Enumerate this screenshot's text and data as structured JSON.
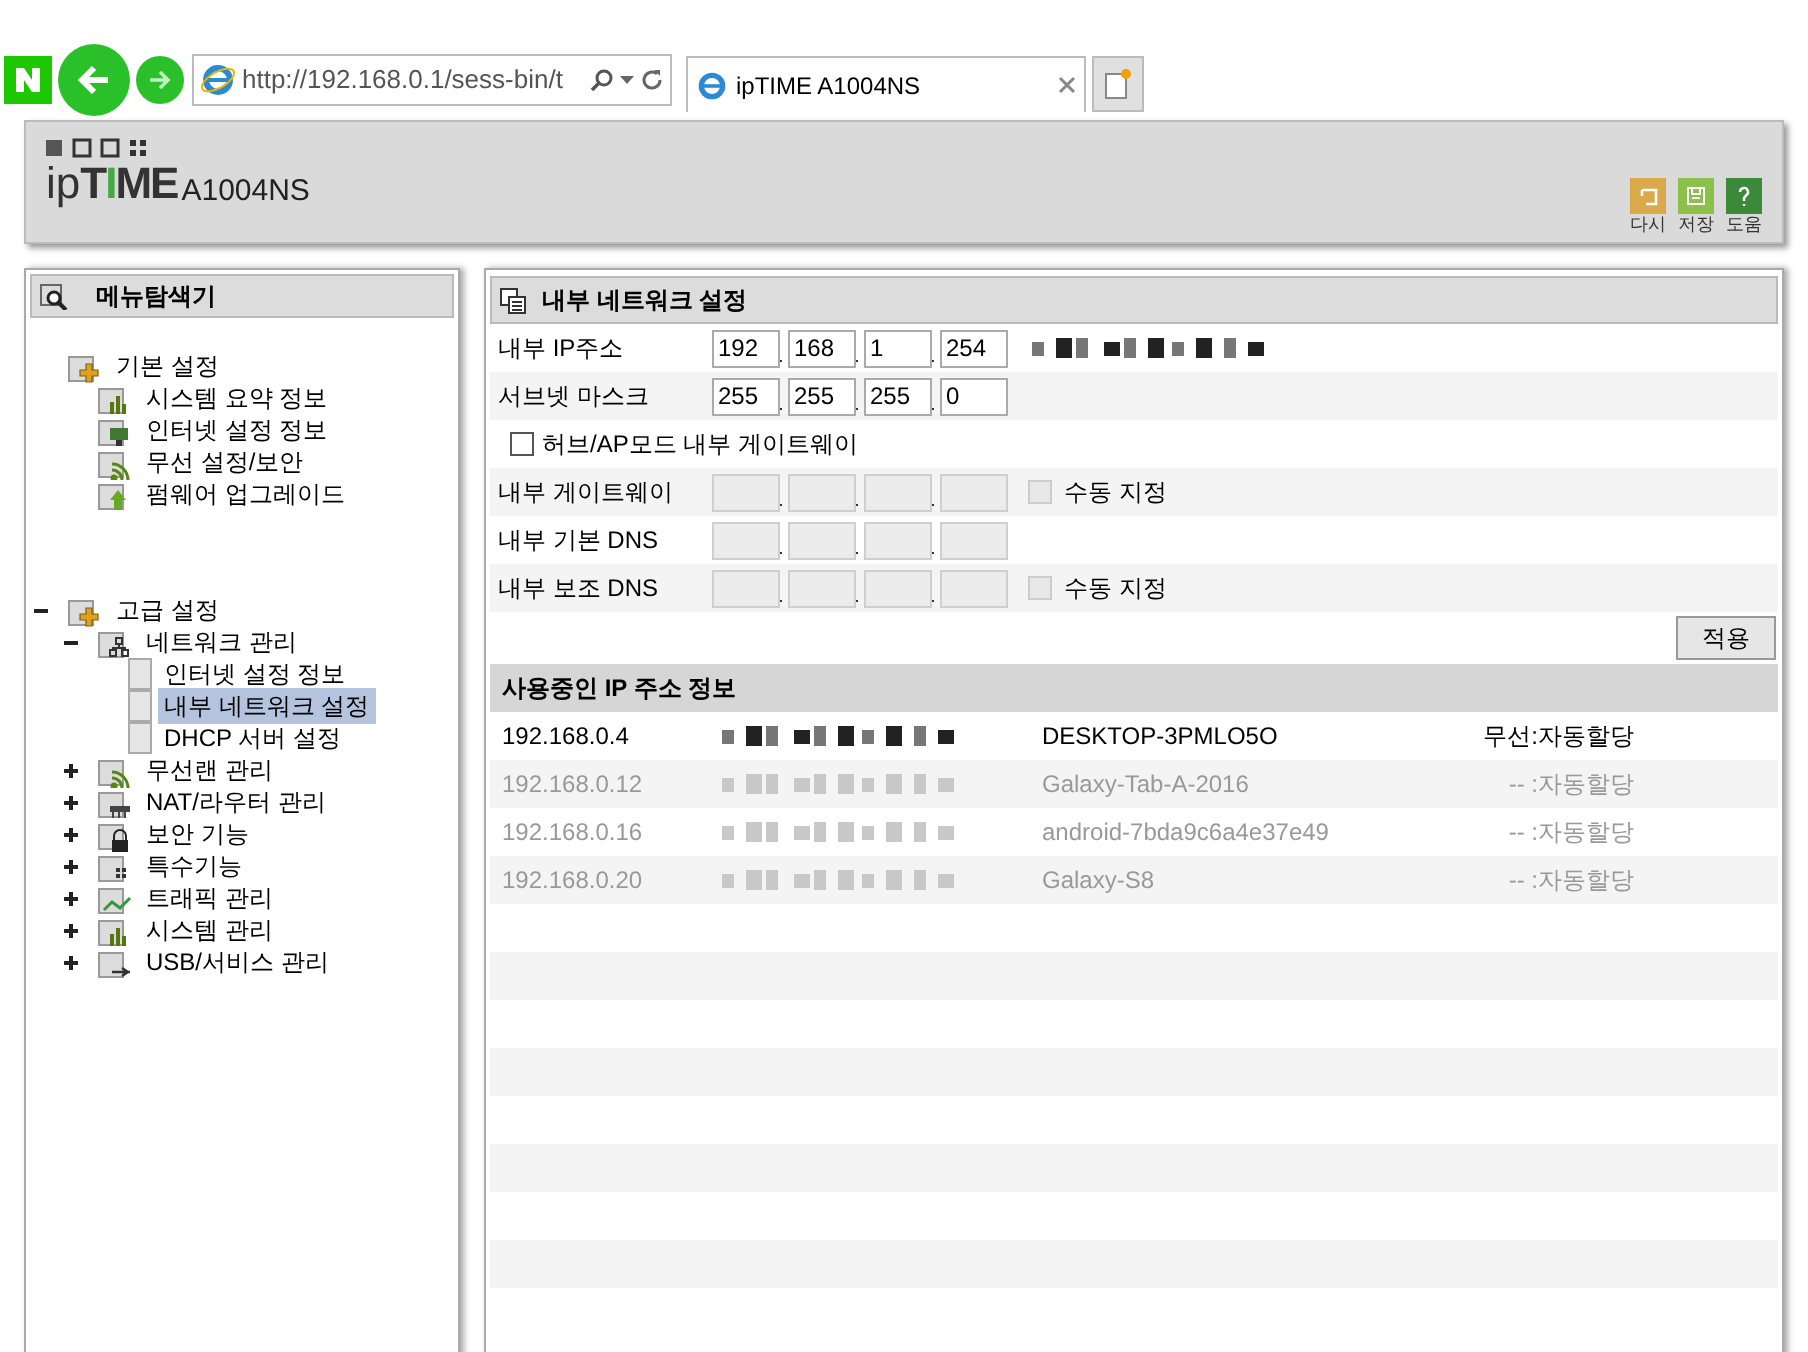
{
  "browser": {
    "address": "http://192.168.0.1/sess-bin/t",
    "tab_title": "ipTIME A1004NS"
  },
  "header": {
    "logo_prefix": "ip",
    "logo_brand": "TIME",
    "model": "A1004NS",
    "tools": [
      {
        "kind": "back",
        "label": "다시"
      },
      {
        "kind": "save",
        "label": "저장"
      },
      {
        "kind": "help",
        "label": "도움"
      }
    ]
  },
  "sidebar": {
    "title": "메뉴탐색기",
    "groups": [
      {
        "label": "기본 설정",
        "kind": "folder-plus",
        "children": [
          {
            "label": "시스템 요약 정보",
            "kind": "chart"
          },
          {
            "label": "인터넷 설정 정보",
            "kind": "monitor"
          },
          {
            "label": "무선 설정/보안",
            "kind": "wifi"
          },
          {
            "label": "펌웨어 업그레이드",
            "kind": "upload"
          }
        ]
      },
      {
        "label": "고급 설정",
        "kind": "folder-plus",
        "expanded": true,
        "children": [
          {
            "label": "네트워크 관리",
            "kind": "network",
            "expanded": true,
            "children": [
              {
                "label": "인터넷 설정 정보",
                "kind": "page",
                "selected": false
              },
              {
                "label": "내부 네트워크 설정",
                "kind": "page",
                "selected": true
              },
              {
                "label": "DHCP 서버 설정",
                "kind": "page",
                "selected": false
              }
            ]
          },
          {
            "label": "무선랜 관리",
            "kind": "wifi",
            "expanded": false
          },
          {
            "label": "NAT/라우터 관리",
            "kind": "router",
            "expanded": false
          },
          {
            "label": "보안 기능",
            "kind": "lock",
            "expanded": false
          },
          {
            "label": "특수기능",
            "kind": "grid",
            "expanded": false
          },
          {
            "label": "트래픽 관리",
            "kind": "traffic",
            "expanded": false
          },
          {
            "label": "시스템 관리",
            "kind": "chart",
            "expanded": false
          },
          {
            "label": "USB/서비스 관리",
            "kind": "usb",
            "expanded": false
          }
        ]
      }
    ]
  },
  "settings": {
    "title": "내부 네트워크 설정",
    "rows": [
      {
        "kind": "ip",
        "label": "내부 IP주소",
        "disabled": false,
        "octets": [
          "192",
          "168",
          "1",
          "254"
        ],
        "redacted": true
      },
      {
        "kind": "ip",
        "label": "서브넷 마스크",
        "disabled": false,
        "octets": [
          "255",
          "255",
          "255",
          "0"
        ],
        "redacted": false
      },
      {
        "kind": "checkbox",
        "label": "허브/AP모드 내부 게이트웨이",
        "checked": false
      },
      {
        "kind": "ip",
        "label": "내부 게이트웨이",
        "disabled": true,
        "manual": {
          "label": "수동 지정",
          "checked": false
        }
      },
      {
        "kind": "ip",
        "label": "내부 기본 DNS",
        "disabled": true
      },
      {
        "kind": "ip",
        "label": "내부 보조 DNS",
        "disabled": true,
        "manual": {
          "label": "수동 지정",
          "checked": false
        }
      }
    ],
    "apply": "적용"
  },
  "leases": {
    "title": "사용중인 IP 주소 정보",
    "rows": [
      {
        "ip": "192.168.0.4",
        "name": "DESKTOP-3PMLO5O",
        "type": "무선:자동할당",
        "active": true
      },
      {
        "ip": "192.168.0.12",
        "name": "Galaxy-Tab-A-2016",
        "type": "-- :자동할당",
        "active": false
      },
      {
        "ip": "192.168.0.16",
        "name": "android-7bda9c6a4e37e49",
        "type": "-- :자동할당",
        "active": false
      },
      {
        "ip": "192.168.0.20",
        "name": "Galaxy-S8",
        "type": "-- :자동할당",
        "active": false
      }
    ]
  }
}
